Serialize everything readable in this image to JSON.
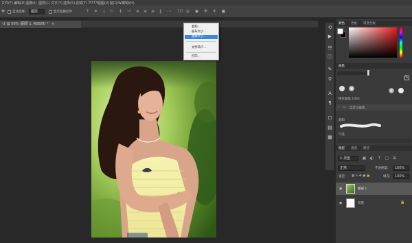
{
  "menubar": {
    "items": [
      "文件(F)",
      "编辑(E)",
      "图像(I)",
      "图层(L)",
      "文字(Y)",
      "选择(S)",
      "滤镜(T)",
      "3D(D)",
      "视图(V)",
      "窗口(W)",
      "帮助(H)"
    ]
  },
  "options_bar": {
    "auto_select_label": "自动选择:",
    "auto_select_value": "图层",
    "show_transform_label": "显示变换控件"
  },
  "document": {
    "tab_title": "-2 @ 50% (图层 1, RGB/8) *",
    "close_glyph": "×"
  },
  "context_menu": {
    "items": [
      {
        "label": "复制...",
        "highlighted": false
      },
      {
        "label": "画布大小...",
        "highlighted": false
      },
      {
        "label": "图像大小...",
        "highlighted": true
      },
      {
        "label": "文件简介...",
        "highlighted": false
      },
      {
        "label": "打印...",
        "highlighted": false
      }
    ]
  },
  "color_panel": {
    "tabs": [
      "颜色",
      "色板",
      "渐变色板"
    ],
    "foreground": "#ffffff",
    "background": "#000000",
    "hue_color": "#e61c1c"
  },
  "brush_panel": {
    "tab": "画笔",
    "size_label": "样本画笔 1044",
    "group_label": "自定义画笔",
    "row_label": "颜料",
    "row2_label": "气笔"
  },
  "layers_panel": {
    "tabs": [
      "图层",
      "通道",
      "路径"
    ],
    "kind_label": "类型",
    "blend_mode": "正常",
    "opacity_label": "不透明度:",
    "opacity_value": "100%",
    "lock_label": "锁定:",
    "fill_label": "填充:",
    "fill_value": "100%",
    "layers": [
      {
        "name": "图层 1",
        "selected": true
      },
      {
        "name": "背景",
        "selected": false,
        "locked": true
      }
    ]
  },
  "colors": {
    "menubar_bg": "#3c3c3c",
    "panel_bg": "#3a3a3a",
    "canvas_bg": "#282828",
    "menu_highlight": "#3a86d9"
  }
}
